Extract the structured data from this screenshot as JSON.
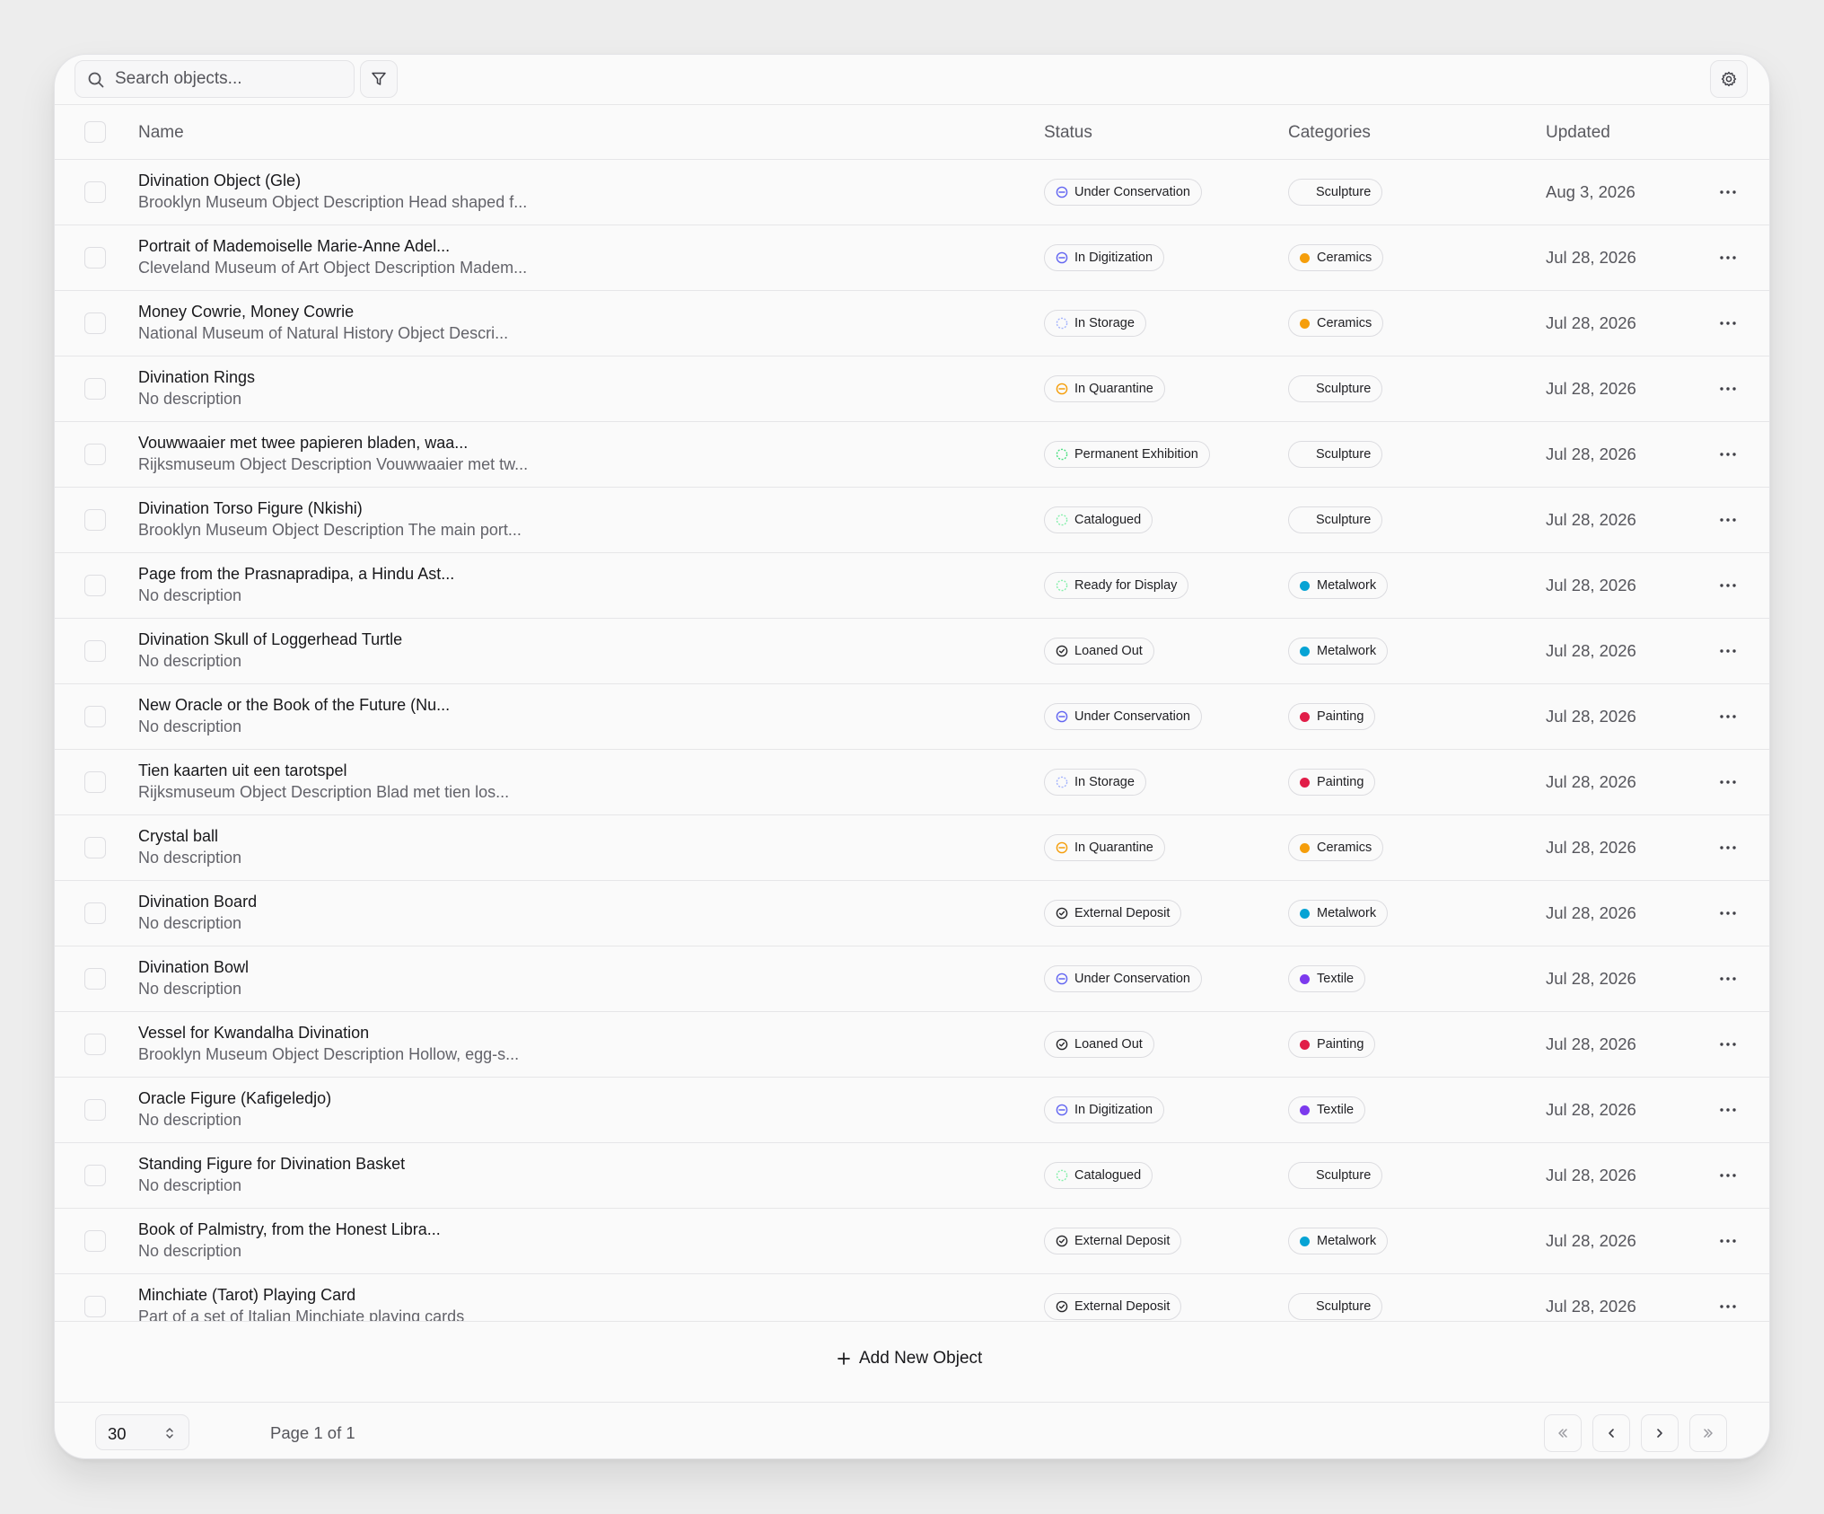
{
  "toolbar": {
    "search_placeholder": "Search objects...",
    "filter_icon": "filter-icon",
    "settings_icon": "settings-icon"
  },
  "table": {
    "headers": {
      "name": "Name",
      "status": "Status",
      "categories": "Categories",
      "updated": "Updated"
    },
    "rows": [
      {
        "title": "Divination Object (Gle)",
        "desc": "Brooklyn Museum Object Description Head shaped f...",
        "status": "Under Conservation",
        "status_icon": "circle-minus-icon",
        "status_color": "#6366f1",
        "category": "Sculpture",
        "category_color": "",
        "updated": "Aug 3, 2026"
      },
      {
        "title": "Portrait of Mademoiselle Marie-Anne Adel...",
        "desc": "Cleveland Museum of Art Object Description Madem...",
        "status": "In Digitization",
        "status_icon": "circle-minus-icon",
        "status_color": "#6366f1",
        "category": "Ceramics",
        "category_color": "#f59e0b",
        "updated": "Jul 28, 2026"
      },
      {
        "title": "Money Cowrie, Money Cowrie",
        "desc": "National Museum of Natural History Object Descri...",
        "status": "In Storage",
        "status_icon": "dashed-circle-icon",
        "status_color": "#a5b4fc",
        "category": "Ceramics",
        "category_color": "#f59e0b",
        "updated": "Jul 28, 2026"
      },
      {
        "title": "Divination Rings",
        "desc": "No description",
        "status": "In Quarantine",
        "status_icon": "circle-minus-icon",
        "status_color": "#f59e0b",
        "category": "Sculpture",
        "category_color": "",
        "updated": "Jul 28, 2026"
      },
      {
        "title": "Vouwwaaier met twee papieren bladen, waa...",
        "desc": "Rijksmuseum Object Description Vouwwaaier met tw...",
        "status": "Permanent Exhibition",
        "status_icon": "dashed-circle-icon",
        "status_color": "#4ade80",
        "category": "Sculpture",
        "category_color": "",
        "updated": "Jul 28, 2026"
      },
      {
        "title": "Divination Torso Figure (Nkishi)",
        "desc": "Brooklyn Museum Object Description The main port...",
        "status": "Catalogued",
        "status_icon": "dashed-circle-icon",
        "status_color": "#86efac",
        "category": "Sculpture",
        "category_color": "",
        "updated": "Jul 28, 2026"
      },
      {
        "title": "Page from the Prasnapradipa, a Hindu Ast...",
        "desc": "No description",
        "status": "Ready for Display",
        "status_icon": "dashed-circle-icon",
        "status_color": "#86efac",
        "category": "Metalwork",
        "category_color": "#06a3d4",
        "updated": "Jul 28, 2026"
      },
      {
        "title": "Divination Skull of Loggerhead Turtle",
        "desc": "No description",
        "status": "Loaned Out",
        "status_icon": "circle-check-icon",
        "status_color": "#27272a",
        "category": "Metalwork",
        "category_color": "#06a3d4",
        "updated": "Jul 28, 2026"
      },
      {
        "title": "New Oracle or the Book of the Future (Nu...",
        "desc": "No description",
        "status": "Under Conservation",
        "status_icon": "circle-minus-icon",
        "status_color": "#6366f1",
        "category": "Painting",
        "category_color": "#e11d48",
        "updated": "Jul 28, 2026"
      },
      {
        "title": "Tien kaarten uit een tarotspel",
        "desc": "Rijksmuseum Object Description Blad met tien los...",
        "status": "In Storage",
        "status_icon": "dashed-circle-icon",
        "status_color": "#a5b4fc",
        "category": "Painting",
        "category_color": "#e11d48",
        "updated": "Jul 28, 2026"
      },
      {
        "title": "Crystal ball",
        "desc": "No description",
        "status": "In Quarantine",
        "status_icon": "circle-minus-icon",
        "status_color": "#f59e0b",
        "category": "Ceramics",
        "category_color": "#f59e0b",
        "updated": "Jul 28, 2026"
      },
      {
        "title": "Divination Board",
        "desc": "No description",
        "status": "External Deposit",
        "status_icon": "circle-check-icon",
        "status_color": "#27272a",
        "category": "Metalwork",
        "category_color": "#06a3d4",
        "updated": "Jul 28, 2026"
      },
      {
        "title": "Divination Bowl",
        "desc": "No description",
        "status": "Under Conservation",
        "status_icon": "circle-minus-icon",
        "status_color": "#6366f1",
        "category": "Textile",
        "category_color": "#7c3aed",
        "updated": "Jul 28, 2026"
      },
      {
        "title": "Vessel for Kwandalha Divination",
        "desc": "Brooklyn Museum Object Description Hollow, egg-s...",
        "status": "Loaned Out",
        "status_icon": "circle-check-icon",
        "status_color": "#27272a",
        "category": "Painting",
        "category_color": "#e11d48",
        "updated": "Jul 28, 2026"
      },
      {
        "title": "Oracle Figure (Kafigeledjo)",
        "desc": "No description",
        "status": "In Digitization",
        "status_icon": "circle-minus-icon",
        "status_color": "#6366f1",
        "category": "Textile",
        "category_color": "#7c3aed",
        "updated": "Jul 28, 2026"
      },
      {
        "title": "Standing Figure for Divination Basket",
        "desc": "No description",
        "status": "Catalogued",
        "status_icon": "dashed-circle-icon",
        "status_color": "#86efac",
        "category": "Sculpture",
        "category_color": "",
        "updated": "Jul 28, 2026"
      },
      {
        "title": "Book of Palmistry, from the Honest Libra...",
        "desc": "No description",
        "status": "External Deposit",
        "status_icon": "circle-check-icon",
        "status_color": "#27272a",
        "category": "Metalwork",
        "category_color": "#06a3d4",
        "updated": "Jul 28, 2026"
      },
      {
        "title": "Minchiate (Tarot) Playing Card",
        "desc": "Part of a set of Italian Minchiate playing cards",
        "status": "External Deposit",
        "status_icon": "circle-check-icon",
        "status_color": "#27272a",
        "category": "Sculpture",
        "category_color": "",
        "updated": "Jul 28, 2026"
      }
    ]
  },
  "footer": {
    "add_label": "Add New Object",
    "page_size": "30",
    "page_info": "Page 1 of 1"
  }
}
